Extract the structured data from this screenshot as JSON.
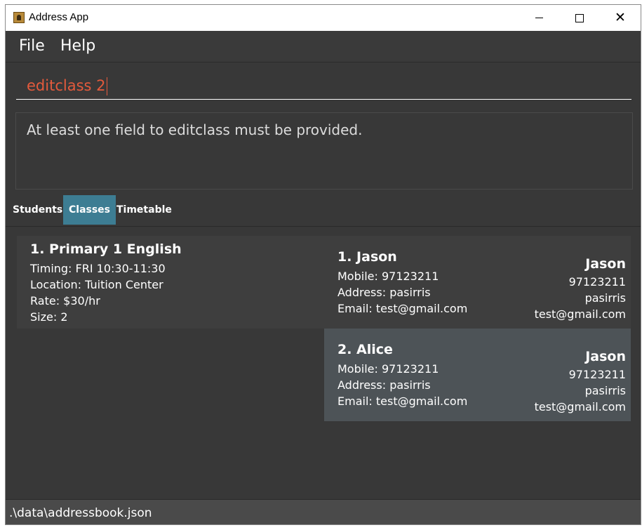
{
  "window": {
    "title": "Address App"
  },
  "menu": {
    "file": "File",
    "help": "Help"
  },
  "command": {
    "value": "editclass 2"
  },
  "result": {
    "message": "At least one field to editclass must be provided."
  },
  "tabs": {
    "students": "Students",
    "classes": "Classes",
    "timetable": "Timetable",
    "active": "Classes"
  },
  "class_card": {
    "title": "1.  Primary 1 English",
    "timing": "Timing: FRI 10:30-11:30",
    "location": "Location: Tuition Center",
    "rate": "Rate: $30/hr",
    "size": "Size: 2"
  },
  "students": [
    {
      "title": "1.  Jason",
      "mobile": "Mobile: 97123211",
      "address": "Address: pasirris",
      "email": "Email: test@gmail.com",
      "right_name": "Jason",
      "right_phone": "97123211",
      "right_address": "pasirris",
      "right_email": "test@gmail.com"
    },
    {
      "title": "2.  Alice",
      "mobile": "Mobile: 97123211",
      "address": "Address: pasirris",
      "email": "Email: test@gmail.com",
      "right_name": "Jason",
      "right_phone": "97123211",
      "right_address": "pasirris",
      "right_email": "test@gmail.com"
    }
  ],
  "status": {
    "path": ".\\data\\addressbook.json"
  },
  "colors": {
    "accent_tab": "#3d7d93",
    "command_text": "#e45a3c",
    "background": "#383838",
    "selected_card": "#4d5357"
  }
}
